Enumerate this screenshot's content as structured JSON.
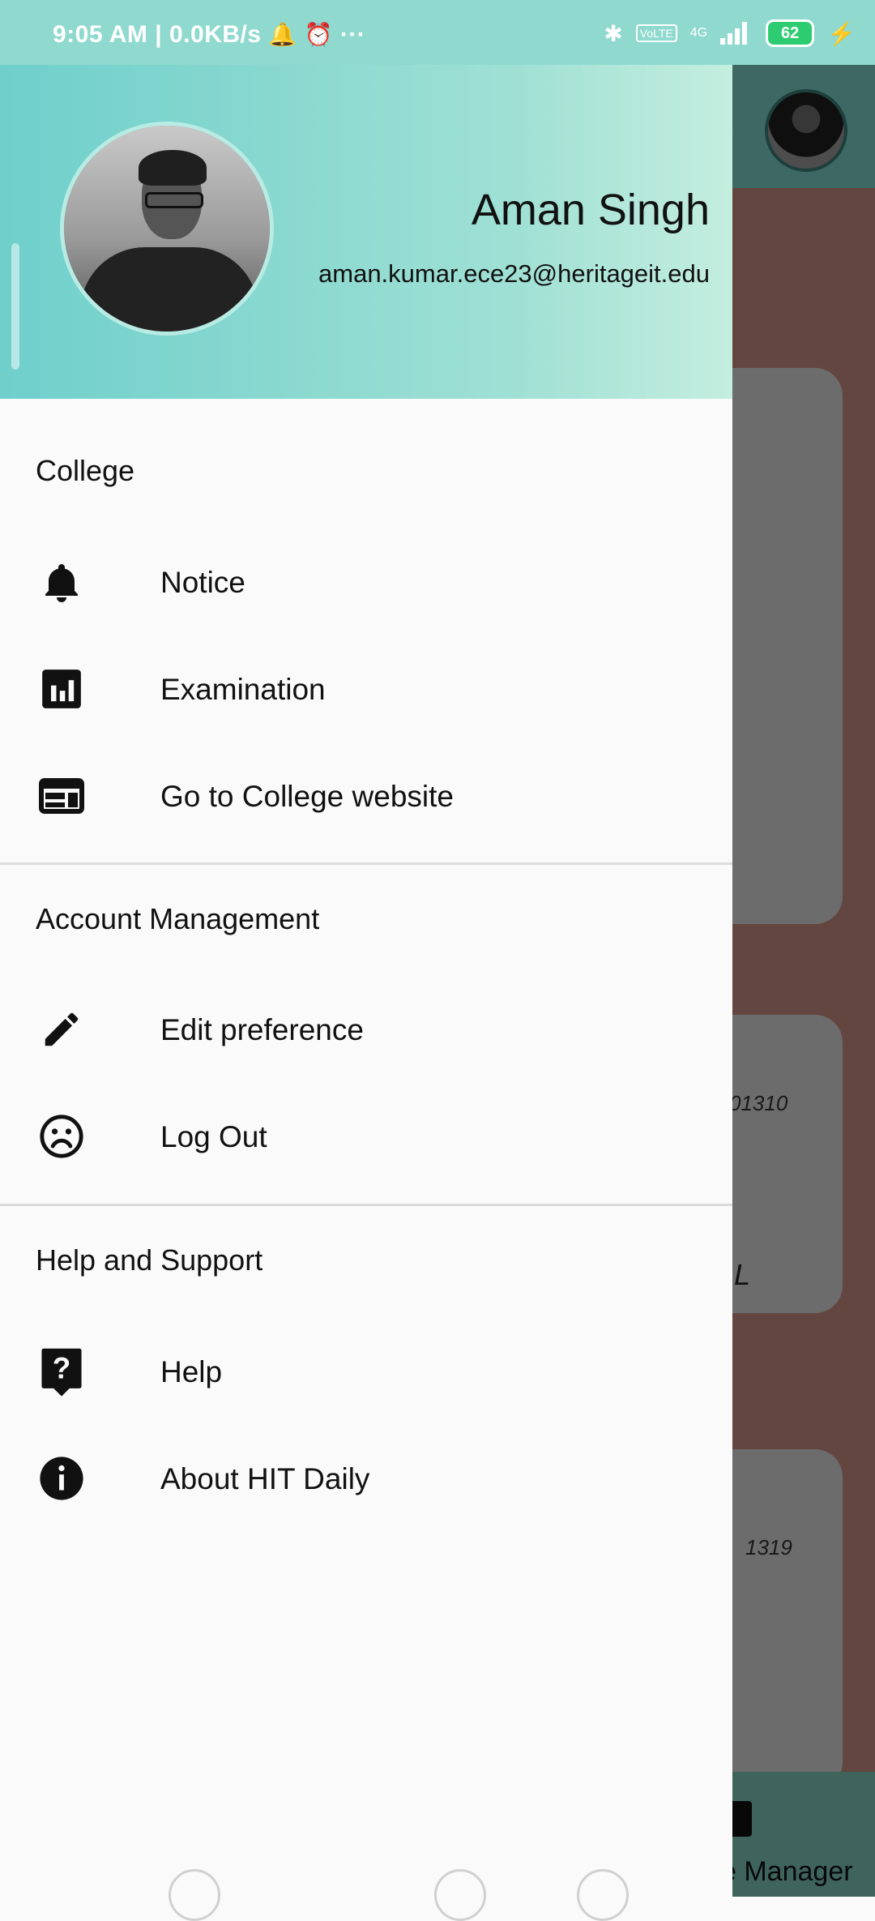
{
  "status_bar": {
    "time_and_speed": "9:05 AM | 0.0KB/s",
    "more": "···",
    "network": "4G",
    "volte": "VoLTE",
    "battery": "62"
  },
  "drawer": {
    "user": {
      "name": "Aman Singh",
      "email": "aman.kumar.ece23@heritageit.edu"
    },
    "sections": [
      {
        "title": "College",
        "items": [
          {
            "label": "Notice",
            "icon": "bell-icon"
          },
          {
            "label": "Examination",
            "icon": "bar-chart-icon"
          },
          {
            "label": "Go to College website",
            "icon": "web-icon"
          }
        ]
      },
      {
        "title": "Account Management",
        "items": [
          {
            "label": "Edit preference",
            "icon": "pencil-icon"
          },
          {
            "label": "Log Out",
            "icon": "sad-face-icon"
          }
        ]
      },
      {
        "title": "Help and Support",
        "items": [
          {
            "label": "Help",
            "icon": "help-icon"
          },
          {
            "label": "About HIT Daily",
            "icon": "info-icon"
          }
        ]
      }
    ]
  },
  "background": {
    "card2_text": "01310",
    "card2_big": "L",
    "card3_text": "1319",
    "bottom_label": "e Manager"
  },
  "colors": {
    "header_start": "#6fcfcb",
    "header_end": "#c4eedf",
    "status_bar": "#8fd9cf"
  }
}
